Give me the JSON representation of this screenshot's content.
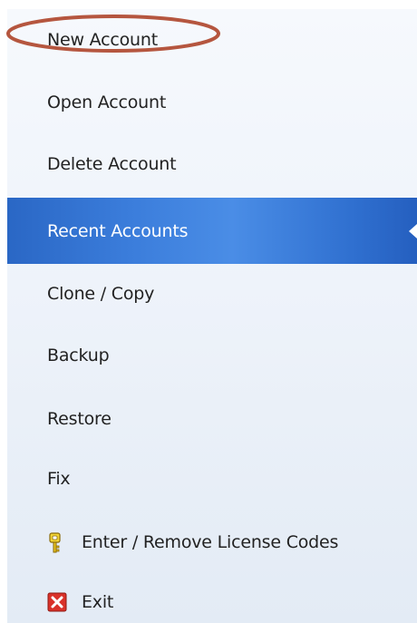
{
  "menu": {
    "items": [
      {
        "label": "New Account"
      },
      {
        "label": "Open Account"
      },
      {
        "label": "Delete Account"
      },
      {
        "label": "Recent Accounts",
        "selected": true
      },
      {
        "label": "Clone / Copy"
      },
      {
        "label": "Backup"
      },
      {
        "label": "Restore"
      },
      {
        "label": "Fix"
      },
      {
        "label": "Enter / Remove License Codes",
        "icon": "key-icon"
      },
      {
        "label": "Exit",
        "icon": "exit-icon"
      }
    ]
  },
  "colors": {
    "selected_background": "#3b7ddb",
    "highlight_ring": "#b5563f",
    "exit_icon": "#d9322a",
    "key_icon": "#e6c21e"
  }
}
